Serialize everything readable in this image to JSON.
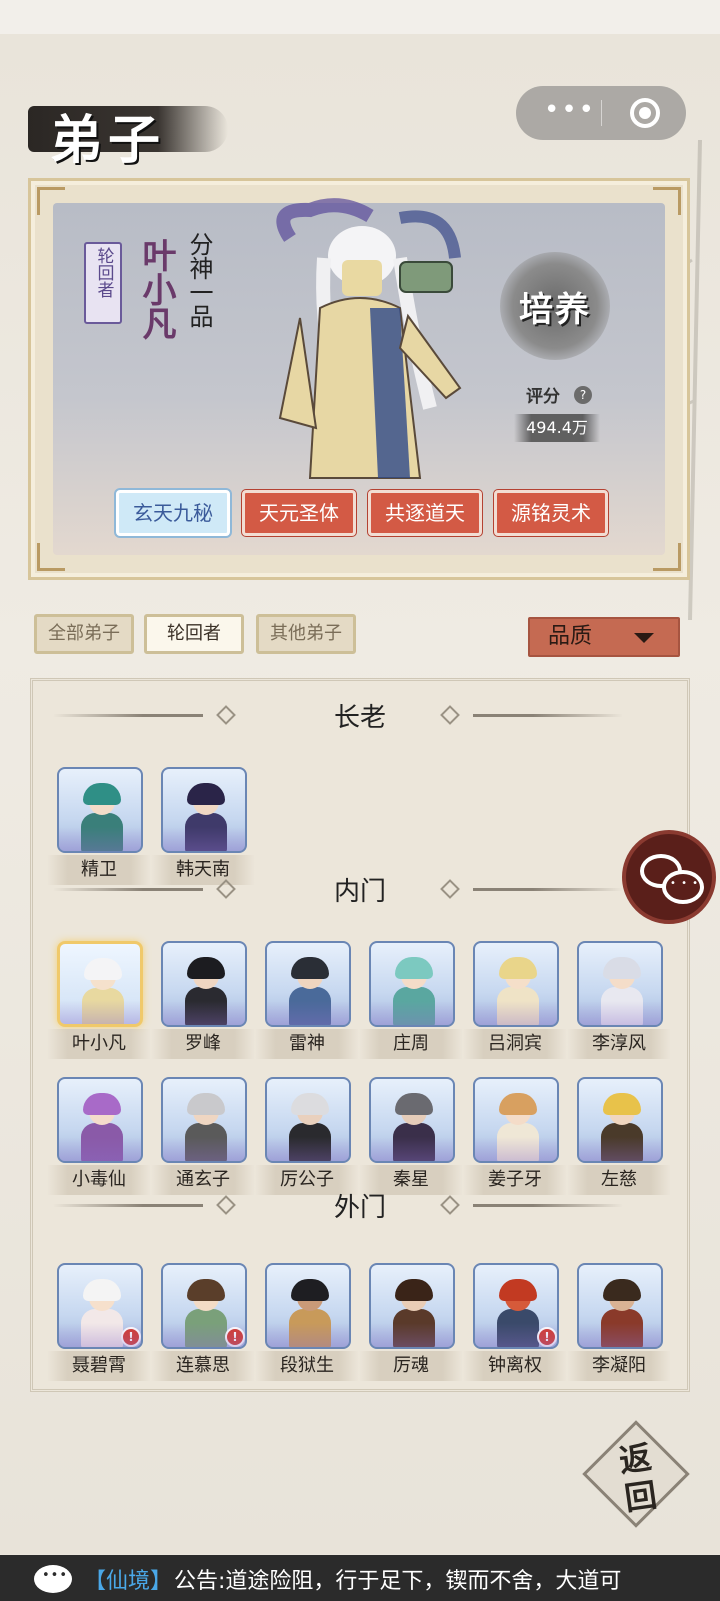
{
  "page": {
    "title": "弟子"
  },
  "hero": {
    "tag": "轮回者",
    "name": "叶小凡",
    "rank": "分神一品",
    "train_label": "培养",
    "score_label": "评分",
    "score_help": "?",
    "score_value": "494.4万",
    "skills": [
      {
        "label": "玄天九秘",
        "selected": true
      },
      {
        "label": "天元圣体",
        "selected": false
      },
      {
        "label": "共逐道天",
        "selected": false
      },
      {
        "label": "源铭灵术",
        "selected": false
      }
    ]
  },
  "filters": {
    "tabs": [
      "全部弟子",
      "轮回者",
      "其他弟子"
    ],
    "active": "轮回者",
    "sort_label": "品质"
  },
  "sections": [
    {
      "title": "长老",
      "members": [
        "精卫",
        "韩天南"
      ]
    },
    {
      "title": "内门",
      "members": [
        "叶小凡",
        "罗峰",
        "雷神",
        "庄周",
        "吕洞宾",
        "李淳风",
        "小毒仙",
        "通玄子",
        "厉公子",
        "秦星",
        "姜子牙",
        "左慈"
      ]
    },
    {
      "title": "外门",
      "members": [
        "聂碧霄",
        "连慕思",
        "段狱生",
        "厉魂",
        "钟离权",
        "李凝阳"
      ],
      "alerts": [
        "!",
        "!",
        "!"
      ]
    }
  ],
  "back_label": "返回",
  "ticker": {
    "tag": "【仙境】",
    "text": "公告:道途险阻，行于足下，锲而不舍，大道可"
  },
  "colors": {
    "accent_red": "#d35a45",
    "panel_bg": "#ece6da",
    "selected_gold": "#f0c96a"
  }
}
